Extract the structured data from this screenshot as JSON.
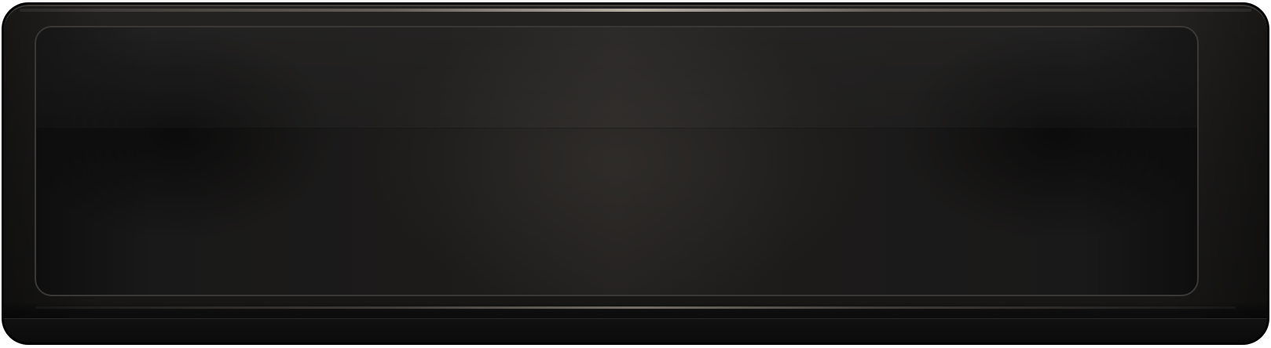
{
  "colors": {
    "frame": "#000000",
    "bezel": "#1d1c1b",
    "panel": "#1c1b1a",
    "panel_border": "#3a3836",
    "sheen": "#d2c8be"
  },
  "display": {
    "text": ""
  }
}
